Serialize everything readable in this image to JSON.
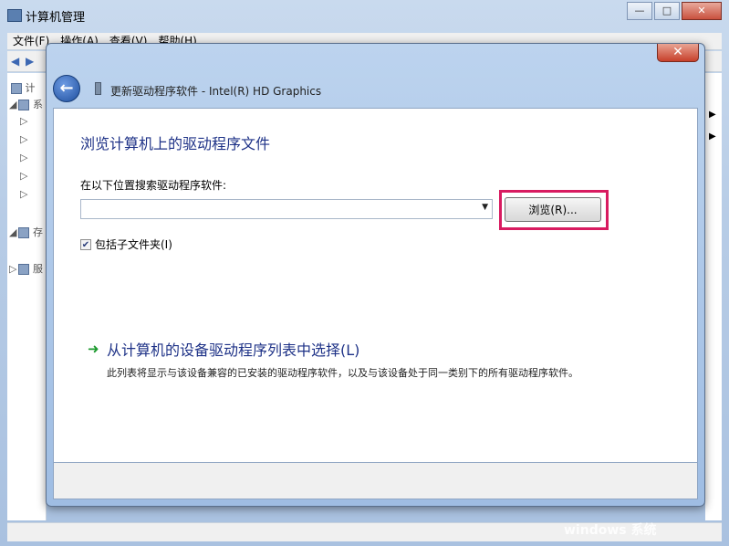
{
  "main_window": {
    "title": "计算机管理",
    "controls": {
      "minimize": "—",
      "maximize": "□",
      "close": "✕"
    },
    "menu": [
      "文件(F)",
      "操作(A)",
      "查看(V)",
      "帮助(H)"
    ],
    "tree_labels": [
      "计",
      "系",
      "存",
      "服"
    ]
  },
  "dialog": {
    "close_glyph": "✕",
    "back_glyph": "←",
    "title": "更新驱动程序软件 - Intel(R) HD Graphics",
    "heading": "浏览计算机上的驱动程序文件",
    "search_label": "在以下位置搜索驱动程序软件:",
    "path_value": "",
    "combo_arrow": "▼",
    "browse_label": "浏览(R)...",
    "include_subfolders": {
      "label": "包括子文件夹(I)",
      "checked": true,
      "glyph": "✔"
    },
    "pick_arrow": "➜",
    "pick_title": "从计算机的设备驱动程序列表中选择(L)",
    "pick_desc": "此列表将显示与该设备兼容的已安装的驱动程序软件，以及与该设备处于同一类别下的所有驱动程序软件。"
  },
  "watermark": "windows 系统"
}
